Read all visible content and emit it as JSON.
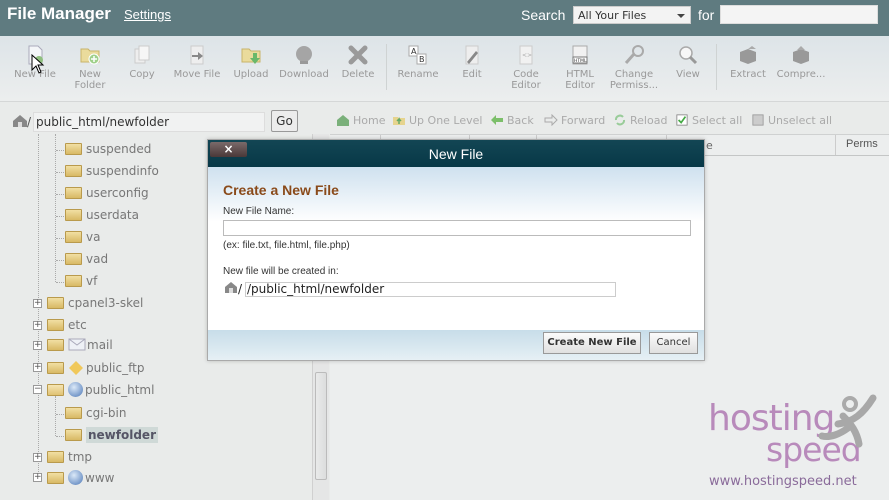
{
  "header": {
    "title": "File Manager",
    "settings_link": "Settings",
    "search_label": "Search",
    "search_scope": "All Your Files",
    "for_label": "for",
    "search_value": ""
  },
  "toolbar": {
    "items": [
      {
        "label": "New File",
        "icon": "new-file-icon"
      },
      {
        "label": "New Folder",
        "icon": "new-folder-icon"
      },
      {
        "label": "Copy",
        "icon": "copy-icon"
      },
      {
        "label": "Move File",
        "icon": "move-file-icon"
      },
      {
        "label": "Upload",
        "icon": "upload-icon"
      },
      {
        "label": "Download",
        "icon": "download-icon"
      },
      {
        "label": "Delete",
        "icon": "delete-icon"
      },
      {
        "label": "Rename",
        "icon": "rename-icon"
      },
      {
        "label": "Edit",
        "icon": "edit-icon"
      },
      {
        "label": "Code Editor",
        "icon": "code-editor-icon"
      },
      {
        "label": "HTML Editor",
        "icon": "html-editor-icon"
      },
      {
        "label": "Change Permiss...",
        "icon": "key-icon"
      },
      {
        "label": "View",
        "icon": "magnifier-icon"
      },
      {
        "label": "Extract",
        "icon": "extract-icon"
      },
      {
        "label": "Compre...",
        "icon": "compress-icon"
      }
    ]
  },
  "pathbar": {
    "slash": "/",
    "path": "public_html/newfolder",
    "go_label": "Go"
  },
  "nav": {
    "home": "Home",
    "up": "Up One Level",
    "back": "Back",
    "forward": "Forward",
    "reload": "Reload",
    "select_all": "Select all",
    "unselect_all": "Unselect all"
  },
  "grid": {
    "perms_header": "Perms",
    "partial_header": "e"
  },
  "tree": {
    "children": [
      "suspended",
      "suspendinfo",
      "userconfig",
      "userdata",
      "va",
      "vad",
      "vf"
    ],
    "roots": [
      {
        "label": "cpanel3-skel"
      },
      {
        "label": "etc"
      },
      {
        "label": "mail"
      },
      {
        "label": "public_ftp"
      },
      {
        "label": "public_html"
      }
    ],
    "public_html_children": [
      "cgi-bin",
      "newfolder"
    ],
    "after": [
      {
        "label": "tmp"
      },
      {
        "label": "www"
      }
    ]
  },
  "dialog": {
    "title": "New File",
    "close": "×",
    "heading": "Create a New File",
    "name_label": "New File Name:",
    "name_value": "",
    "example": "(ex: file.txt, file.html, file.php)",
    "location_label": "New file will be created in:",
    "location_value": "/public_html/newfolder",
    "location_prefix": "/",
    "create_button": "Create New File",
    "cancel_button": "Cancel"
  },
  "watermark": {
    "line1": "hosting",
    "line2": "speed",
    "url": "www.hostingspeed.net"
  }
}
